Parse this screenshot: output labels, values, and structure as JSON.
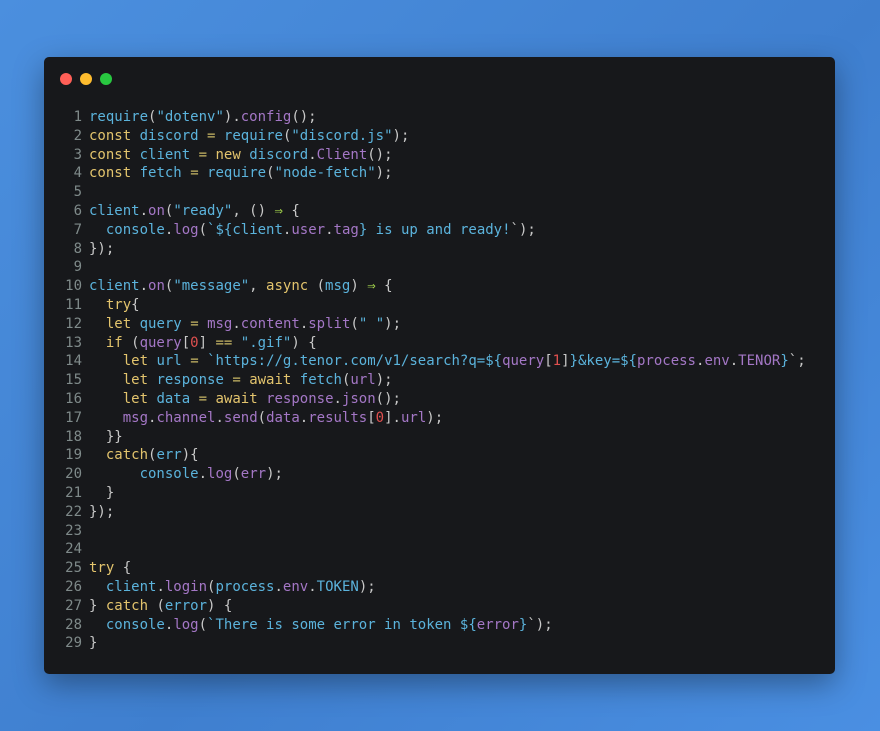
{
  "window": {
    "controls": [
      "close",
      "minimize",
      "maximize"
    ],
    "colors": {
      "close": "#ff5f57",
      "minimize": "#febc2e",
      "maximize": "#28c840",
      "background": "#17181b"
    }
  },
  "code": {
    "language": "javascript",
    "lines": [
      [
        [
          "id",
          "require"
        ],
        [
          "pu",
          "("
        ],
        [
          "st",
          "\"dotenv\""
        ],
        [
          "pu",
          ")."
        ],
        [
          "pr",
          "config"
        ],
        [
          "pu",
          "();"
        ]
      ],
      [
        [
          "kw",
          "const"
        ],
        [
          "pu",
          " "
        ],
        [
          "id",
          "discord"
        ],
        [
          "pu",
          " "
        ],
        [
          "op",
          "="
        ],
        [
          "pu",
          " "
        ],
        [
          "id",
          "require"
        ],
        [
          "pu",
          "("
        ],
        [
          "st",
          "\"discord.js\""
        ],
        [
          "pu",
          ");"
        ]
      ],
      [
        [
          "kw",
          "const"
        ],
        [
          "pu",
          " "
        ],
        [
          "id",
          "client"
        ],
        [
          "pu",
          " "
        ],
        [
          "op",
          "="
        ],
        [
          "pu",
          " "
        ],
        [
          "kw",
          "new"
        ],
        [
          "pu",
          " "
        ],
        [
          "id",
          "discord"
        ],
        [
          "pu",
          "."
        ],
        [
          "pr",
          "Client"
        ],
        [
          "pu",
          "();"
        ]
      ],
      [
        [
          "kw",
          "const"
        ],
        [
          "pu",
          " "
        ],
        [
          "id",
          "fetch"
        ],
        [
          "pu",
          " "
        ],
        [
          "op",
          "="
        ],
        [
          "pu",
          " "
        ],
        [
          "id",
          "require"
        ],
        [
          "pu",
          "("
        ],
        [
          "st",
          "\"node-fetch\""
        ],
        [
          "pu",
          ");"
        ]
      ],
      [],
      [
        [
          "id",
          "client"
        ],
        [
          "pu",
          "."
        ],
        [
          "pr",
          "on"
        ],
        [
          "pu",
          "("
        ],
        [
          "st",
          "\"ready\""
        ],
        [
          "pu",
          ", () "
        ],
        [
          "ar",
          "⇒"
        ],
        [
          "pu",
          " {"
        ]
      ],
      [
        [
          "pu",
          "  "
        ],
        [
          "id",
          "console"
        ],
        [
          "pu",
          "."
        ],
        [
          "pr",
          "log"
        ],
        [
          "pu",
          "("
        ],
        [
          "st",
          "`${"
        ],
        [
          "id",
          "client"
        ],
        [
          "pu",
          "."
        ],
        [
          "pr",
          "user"
        ],
        [
          "pu",
          "."
        ],
        [
          "pr",
          "tag"
        ],
        [
          "st",
          "} is up and ready!"
        ],
        [
          "pu",
          "`);"
        ]
      ],
      [
        [
          "pu",
          "});"
        ]
      ],
      [],
      [
        [
          "id",
          "client"
        ],
        [
          "pu",
          "."
        ],
        [
          "pr",
          "on"
        ],
        [
          "pu",
          "("
        ],
        [
          "st",
          "\"message\""
        ],
        [
          "pu",
          ", "
        ],
        [
          "kw",
          "async"
        ],
        [
          "pu",
          " ("
        ],
        [
          "id",
          "msg"
        ],
        [
          "pu",
          ") "
        ],
        [
          "ar",
          "⇒"
        ],
        [
          "pu",
          " {"
        ]
      ],
      [
        [
          "pu",
          "  "
        ],
        [
          "kw",
          "try"
        ],
        [
          "pu",
          "{"
        ]
      ],
      [
        [
          "pu",
          "  "
        ],
        [
          "kw",
          "let"
        ],
        [
          "pu",
          " "
        ],
        [
          "id",
          "query"
        ],
        [
          "pu",
          " "
        ],
        [
          "op",
          "="
        ],
        [
          "pu",
          " "
        ],
        [
          "pr",
          "msg"
        ],
        [
          "pu",
          "."
        ],
        [
          "pr",
          "content"
        ],
        [
          "pu",
          "."
        ],
        [
          "pr",
          "split"
        ],
        [
          "pu",
          "("
        ],
        [
          "st",
          "\" \""
        ],
        [
          "pu",
          ");"
        ]
      ],
      [
        [
          "pu",
          "  "
        ],
        [
          "kw",
          "if"
        ],
        [
          "pu",
          " ("
        ],
        [
          "pr",
          "query"
        ],
        [
          "pu",
          "["
        ],
        [
          "nm",
          "0"
        ],
        [
          "pu",
          "] "
        ],
        [
          "op",
          "=="
        ],
        [
          "pu",
          " "
        ],
        [
          "st",
          "\".gif\""
        ],
        [
          "pu",
          ") {"
        ]
      ],
      [
        [
          "pu",
          "    "
        ],
        [
          "kw",
          "let"
        ],
        [
          "pu",
          " "
        ],
        [
          "id",
          "url"
        ],
        [
          "pu",
          " "
        ],
        [
          "op",
          "="
        ],
        [
          "pu",
          " "
        ],
        [
          "st",
          "`https://g.tenor.com/v1/search?q=${"
        ],
        [
          "pr",
          "query"
        ],
        [
          "pu",
          "["
        ],
        [
          "nm",
          "1"
        ],
        [
          "pu",
          "]"
        ],
        [
          "st",
          "}&key=${"
        ],
        [
          "pr",
          "process"
        ],
        [
          "pu",
          "."
        ],
        [
          "pr",
          "env"
        ],
        [
          "pu",
          "."
        ],
        [
          "pr",
          "TENOR"
        ],
        [
          "st",
          "}"
        ],
        [
          "pu",
          "`;"
        ]
      ],
      [
        [
          "pu",
          "    "
        ],
        [
          "kw",
          "let"
        ],
        [
          "pu",
          " "
        ],
        [
          "id",
          "response"
        ],
        [
          "pu",
          " "
        ],
        [
          "op",
          "="
        ],
        [
          "pu",
          " "
        ],
        [
          "kw",
          "await"
        ],
        [
          "pu",
          " "
        ],
        [
          "id",
          "fetch"
        ],
        [
          "pu",
          "("
        ],
        [
          "pr",
          "url"
        ],
        [
          "pu",
          ");"
        ]
      ],
      [
        [
          "pu",
          "    "
        ],
        [
          "kw",
          "let"
        ],
        [
          "pu",
          " "
        ],
        [
          "id",
          "data"
        ],
        [
          "pu",
          " "
        ],
        [
          "op",
          "="
        ],
        [
          "pu",
          " "
        ],
        [
          "kw",
          "await"
        ],
        [
          "pu",
          " "
        ],
        [
          "pr",
          "response"
        ],
        [
          "pu",
          "."
        ],
        [
          "pr",
          "json"
        ],
        [
          "pu",
          "();"
        ]
      ],
      [
        [
          "pu",
          "    "
        ],
        [
          "pr",
          "msg"
        ],
        [
          "pu",
          "."
        ],
        [
          "pr",
          "channel"
        ],
        [
          "pu",
          "."
        ],
        [
          "pr",
          "send"
        ],
        [
          "pu",
          "("
        ],
        [
          "pr",
          "data"
        ],
        [
          "pu",
          "."
        ],
        [
          "pr",
          "results"
        ],
        [
          "pu",
          "["
        ],
        [
          "nm",
          "0"
        ],
        [
          "pu",
          "]."
        ],
        [
          "pr",
          "url"
        ],
        [
          "pu",
          ");"
        ]
      ],
      [
        [
          "pu",
          "  }}"
        ]
      ],
      [
        [
          "pu",
          "  "
        ],
        [
          "kw",
          "catch"
        ],
        [
          "pu",
          "("
        ],
        [
          "id",
          "err"
        ],
        [
          "pu",
          "){"
        ]
      ],
      [
        [
          "pu",
          "      "
        ],
        [
          "id",
          "console"
        ],
        [
          "pu",
          "."
        ],
        [
          "pr",
          "log"
        ],
        [
          "pu",
          "("
        ],
        [
          "pr",
          "err"
        ],
        [
          "pu",
          ");"
        ]
      ],
      [
        [
          "pu",
          "  }"
        ]
      ],
      [
        [
          "pu",
          "});"
        ]
      ],
      [],
      [],
      [
        [
          "kw",
          "try"
        ],
        [
          "pu",
          " {"
        ]
      ],
      [
        [
          "pu",
          "  "
        ],
        [
          "id",
          "client"
        ],
        [
          "pu",
          "."
        ],
        [
          "pr",
          "login"
        ],
        [
          "pu",
          "("
        ],
        [
          "id",
          "process"
        ],
        [
          "pu",
          "."
        ],
        [
          "pr",
          "env"
        ],
        [
          "pu",
          "."
        ],
        [
          "id",
          "TOKEN"
        ],
        [
          "pu",
          ");"
        ]
      ],
      [
        [
          "pu",
          "} "
        ],
        [
          "kw",
          "catch"
        ],
        [
          "pu",
          " ("
        ],
        [
          "id",
          "error"
        ],
        [
          "pu",
          ") {"
        ]
      ],
      [
        [
          "pu",
          "  "
        ],
        [
          "id",
          "console"
        ],
        [
          "pu",
          "."
        ],
        [
          "pr",
          "log"
        ],
        [
          "pu",
          "("
        ],
        [
          "st",
          "`There is some error in token ${"
        ],
        [
          "pr",
          "error"
        ],
        [
          "st",
          "}"
        ],
        [
          "pu",
          "`);"
        ]
      ],
      [
        [
          "pu",
          "}"
        ]
      ]
    ]
  }
}
